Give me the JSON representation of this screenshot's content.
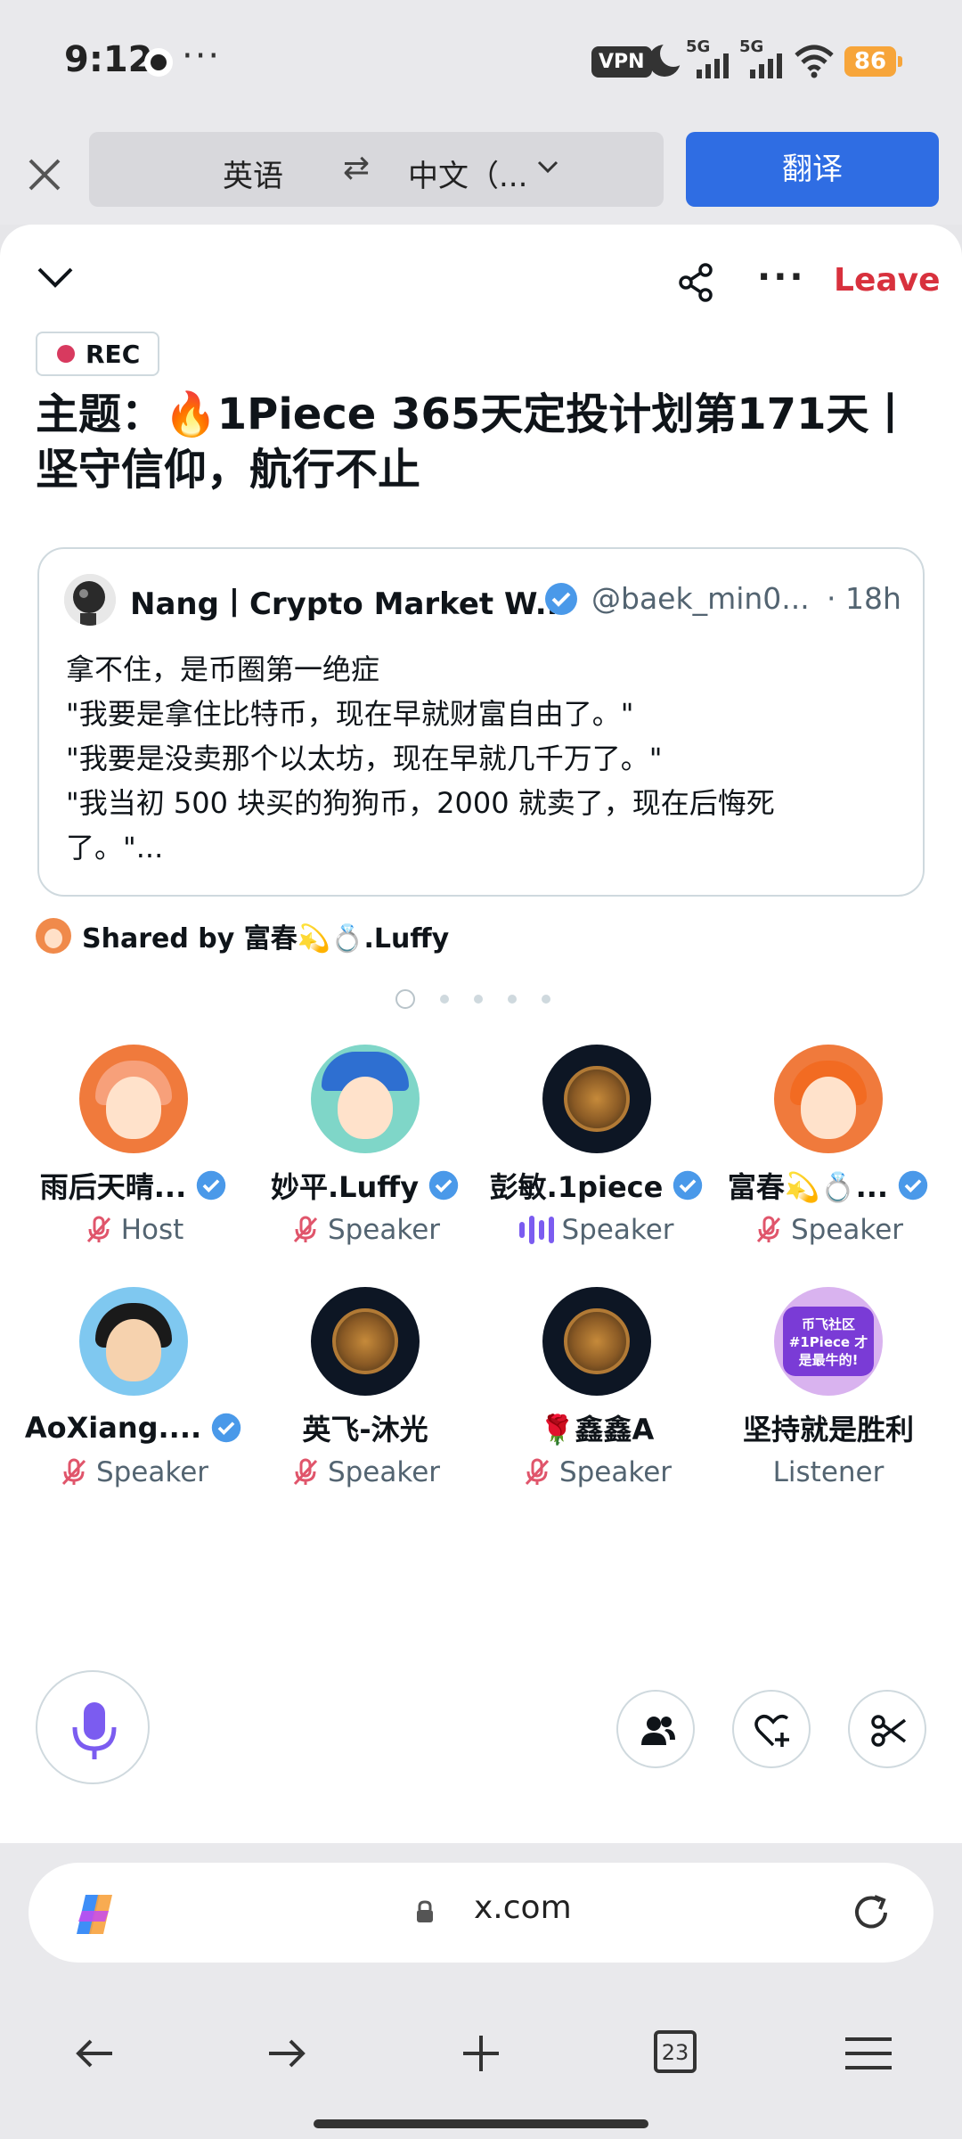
{
  "status_bar": {
    "time": "9:12",
    "more": "···",
    "vpn": "VPN",
    "signal_label_1": "5G",
    "signal_label_2": "5G",
    "battery": "86"
  },
  "translate_bar": {
    "source_lang": "英语",
    "swap_icon": "⇄",
    "target_lang": "中文（...",
    "translate_button": "翻译"
  },
  "space": {
    "leave_label": "Leave",
    "rec_label": "REC",
    "title": "主题：🔥1Piece 365天定投计划第171天丨坚守信仰，航行不止",
    "pinned_tweet": {
      "author_name": "Nang丨Crypto Market W...",
      "handle": "@baek_min0...",
      "time": "· 18h",
      "lines": [
        "拿不住，是币圈第一绝症",
        "\"我要是拿住比特币，现在早就财富自由了。\"",
        "\"我要是没卖那个以太坊，现在早就几千万了。\"",
        "\"我当初 500 块买的狗狗币，2000 就卖了，现在后悔死",
        "了。\"..."
      ]
    },
    "shared_by": "Shared by 富春💫💍.Luffy",
    "page_dots": 5,
    "participants": [
      {
        "name": "雨后天晴...",
        "role": "Host",
        "verified": true,
        "mic": "muted",
        "avatar": "orange-hair-girl"
      },
      {
        "name": "妙平.Luffy",
        "role": "Speaker",
        "verified": true,
        "mic": "muted",
        "avatar": "bandana-girl"
      },
      {
        "name": "彭敏.1piece",
        "role": "Speaker",
        "verified": true,
        "mic": "speaking",
        "avatar": "medal"
      },
      {
        "name": "富春💫💍...",
        "role": "Speaker",
        "verified": true,
        "mic": "muted",
        "avatar": "orange-hair-girl"
      },
      {
        "name": "AoXiang....",
        "role": "Speaker",
        "verified": true,
        "mic": "muted",
        "avatar": "luffy-horns"
      },
      {
        "name": "英飞-沐光",
        "role": "Speaker",
        "verified": false,
        "mic": "muted",
        "avatar": "medal"
      },
      {
        "name": "🌹鑫鑫A",
        "role": "Speaker",
        "verified": false,
        "mic": "muted",
        "avatar": "medal"
      },
      {
        "name": "坚持就是胜利",
        "role": "Listener",
        "verified": false,
        "mic": "none",
        "avatar": "1piece-badge"
      }
    ],
    "badge_text": "币飞社区 #1Piece 才是最牛的!"
  },
  "browser": {
    "url": "x.com",
    "tab_count": "23"
  },
  "colors": {
    "accent_blue": "#2f6de3",
    "leave_red": "#d8313d",
    "verified_blue": "#4a99e9",
    "speaking_purple": "#7b5cf0",
    "rec_dot": "#d83a5f"
  }
}
